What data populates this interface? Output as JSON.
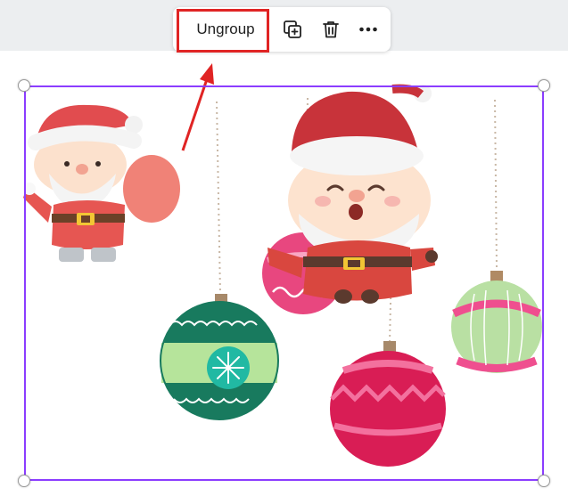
{
  "toolbar": {
    "ungroup_label": "Ungroup",
    "actions": [
      {
        "name": "duplicate",
        "icon": "duplicate-icon"
      },
      {
        "name": "delete",
        "icon": "trash-icon"
      },
      {
        "name": "more",
        "icon": "more-dots-icon"
      }
    ]
  },
  "annotation": {
    "highlight_color": "#e02424",
    "target": "Ungroup"
  },
  "selection": {
    "color": "#8b3dff",
    "handles": [
      "top-left",
      "top-right",
      "bottom-left",
      "bottom-right"
    ]
  },
  "canvas": {
    "elements": [
      "santa-with-sack",
      "santa-with-hat",
      "ornament-green-snowflake",
      "ornament-pink-small",
      "ornament-red-zigzag",
      "ornament-green-striped"
    ]
  }
}
